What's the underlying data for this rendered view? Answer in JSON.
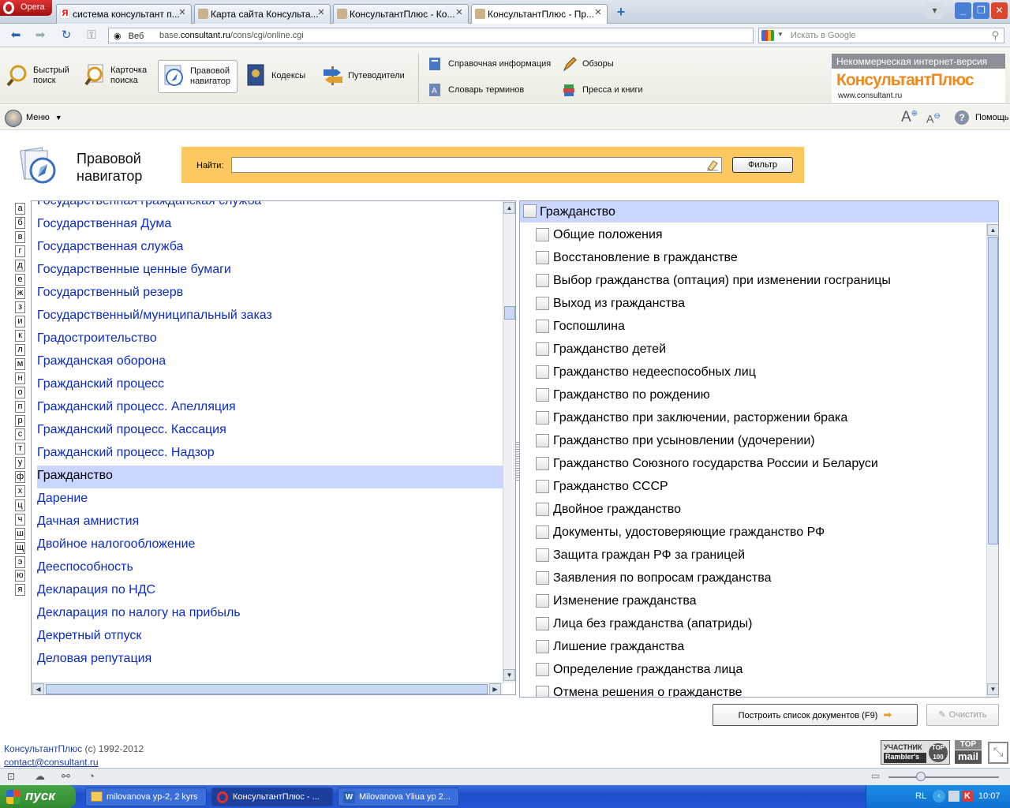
{
  "browser": {
    "opera_label": "Opera",
    "tabs": [
      {
        "title": "система консультант п..."
      },
      {
        "title": "Карта сайта Консульта..."
      },
      {
        "title": "КонсультантПлюс - Ко..."
      },
      {
        "title": "КонсультантПлюс - Пр..."
      }
    ],
    "address": {
      "scheme_label": "Веб",
      "url_prefix": "base.",
      "url_host": "consultant.ru",
      "url_path": "/cons/cgi/online.cgi"
    },
    "search_placeholder": "Искать в Google"
  },
  "toolbar": {
    "buttons": [
      {
        "label1": "Быстрый",
        "label2": "поиск"
      },
      {
        "label1": "Карточка",
        "label2": "поиска"
      },
      {
        "label1": "Правовой",
        "label2": "навигатор"
      },
      {
        "label1": "Кодексы",
        "label2": ""
      },
      {
        "label1": "Путеводители",
        "label2": ""
      }
    ],
    "links": [
      {
        "label": "Справочная информация"
      },
      {
        "label": "Обзоры"
      },
      {
        "label": "Словарь терминов"
      },
      {
        "label": "Пресса и книги"
      }
    ],
    "brand": {
      "banner": "Некоммерческая интернет-версия",
      "logo": "КонсультантПлюс",
      "site": "www.consultant.ru"
    }
  },
  "menu": {
    "label": "Меню",
    "help": "Помощь"
  },
  "page": {
    "title_line1": "Правовой",
    "title_line2": "навигатор",
    "find_label": "Найти:",
    "find_value": "",
    "filter_button": "Фильтр"
  },
  "alphabet": [
    "а",
    "б",
    "в",
    "г",
    "д",
    "е",
    "ж",
    "з",
    "и",
    "к",
    "л",
    "м",
    "н",
    "о",
    "п",
    "р",
    "с",
    "т",
    "у",
    "ф",
    "х",
    "ц",
    "ч",
    "ш",
    "щ",
    "э",
    "ю",
    "я"
  ],
  "left_list": [
    {
      "label": "Государственная гражданская служба"
    },
    {
      "label": "Государственная Дума"
    },
    {
      "label": "Государственная служба"
    },
    {
      "label": "Государственные ценные бумаги"
    },
    {
      "label": "Государственный резерв"
    },
    {
      "label": "Государственный/муниципальный заказ"
    },
    {
      "label": "Градостроительство"
    },
    {
      "label": "Гражданская оборона"
    },
    {
      "label": "Гражданский процесс"
    },
    {
      "label": "Гражданский процесс. Апелляция"
    },
    {
      "label": "Гражданский процесс. Кассация"
    },
    {
      "label": "Гражданский процесс. Надзор"
    },
    {
      "label": "Гражданство"
    },
    {
      "label": "Дарение"
    },
    {
      "label": "Дачная амнистия"
    },
    {
      "label": "Двойное налогообложение"
    },
    {
      "label": "Дееспособность"
    },
    {
      "label": "Декларация по НДС"
    },
    {
      "label": "Декларация по налогу на прибыль"
    },
    {
      "label": "Декретный отпуск"
    },
    {
      "label": "Деловая репутация"
    }
  ],
  "left_selected_index": 12,
  "right_panel": {
    "heading": "Гражданство",
    "items": [
      {
        "label": "Общие положения"
      },
      {
        "label": "Восстановление в гражданстве"
      },
      {
        "label": "Выбор гражданства (оптация) при изменении госграницы"
      },
      {
        "label": "Выход из гражданства"
      },
      {
        "label": "Госпошлина"
      },
      {
        "label": "Гражданство детей"
      },
      {
        "label": "Гражданство недееспособных лиц"
      },
      {
        "label": "Гражданство по рождению"
      },
      {
        "label": "Гражданство при заключении, расторжении брака"
      },
      {
        "label": "Гражданство при усыновлении (удочерении)"
      },
      {
        "label": "Гражданство Союзного государства России и Беларуси"
      },
      {
        "label": "Гражданство СССР"
      },
      {
        "label": "Двойное гражданство"
      },
      {
        "label": "Документы, удостоверяющие гражданство РФ"
      },
      {
        "label": "Защита граждан РФ за границей"
      },
      {
        "label": "Заявления по вопросам гражданства"
      },
      {
        "label": "Изменение гражданства"
      },
      {
        "label": "Лица без гражданства (апатриды)"
      },
      {
        "label": "Лишение гражданства"
      },
      {
        "label": "Определение гражданства лица"
      },
      {
        "label": "Отмена решения о гражданстве"
      }
    ]
  },
  "actions": {
    "build_list": "Построить список документов (F9)",
    "clear": "Очистить"
  },
  "footer": {
    "brand": "КонсультантПлюс",
    "copyright": "(c) 1992-2012",
    "email": "contact@consultant.ru",
    "badge1_top": "УЧАСТНИК",
    "badge1_bottom": "Rambler's",
    "badge1_num": "TOP 100",
    "badge2_top": "TOP",
    "badge2_bottom": "mail"
  },
  "taskbar": {
    "start": "пуск",
    "tasks": [
      {
        "label": "milovanova yp-2, 2 kyrs"
      },
      {
        "label": "КонсультантПлюс - ..."
      },
      {
        "label": "Milovanova Yliua yp 2..."
      }
    ],
    "lang": "RL",
    "clock": "10:07"
  },
  "colors": {
    "link": "#0b2bc4",
    "selection": "#c9d6ff",
    "find_bar": "#fcc85f",
    "brand_orange": "#f08a1c"
  }
}
